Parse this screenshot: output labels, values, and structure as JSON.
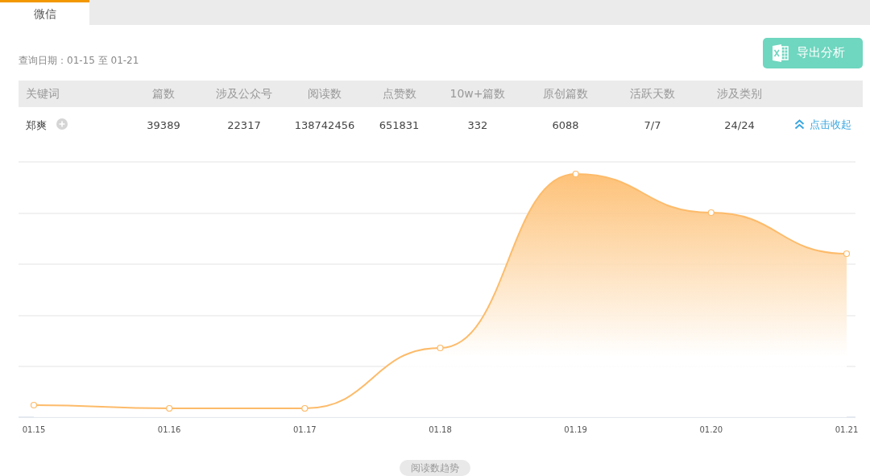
{
  "tabs": [
    {
      "label": "微信",
      "selected": true
    }
  ],
  "query_date": "查询日期：01-15 至 01-21",
  "export_button": {
    "label": "导出分析"
  },
  "table": {
    "columns": [
      "关键词",
      "篇数",
      "涉及公众号",
      "阅读数",
      "点赞数",
      "10w+篇数",
      "原创篇数",
      "活跃天数",
      "涉及类别"
    ],
    "rows": [
      {
        "cells": [
          "郑爽",
          "39389",
          "22317",
          "138742456",
          "651831",
          "332",
          "6088",
          "7/7",
          "24/24"
        ],
        "toggle_label": "点击收起"
      }
    ]
  },
  "chart": {
    "x_labels": [
      "01.15",
      "01.16",
      "01.17",
      "01.18",
      "01.19",
      "01.20",
      "01.21"
    ],
    "legend": "阅读数趋势"
  }
}
